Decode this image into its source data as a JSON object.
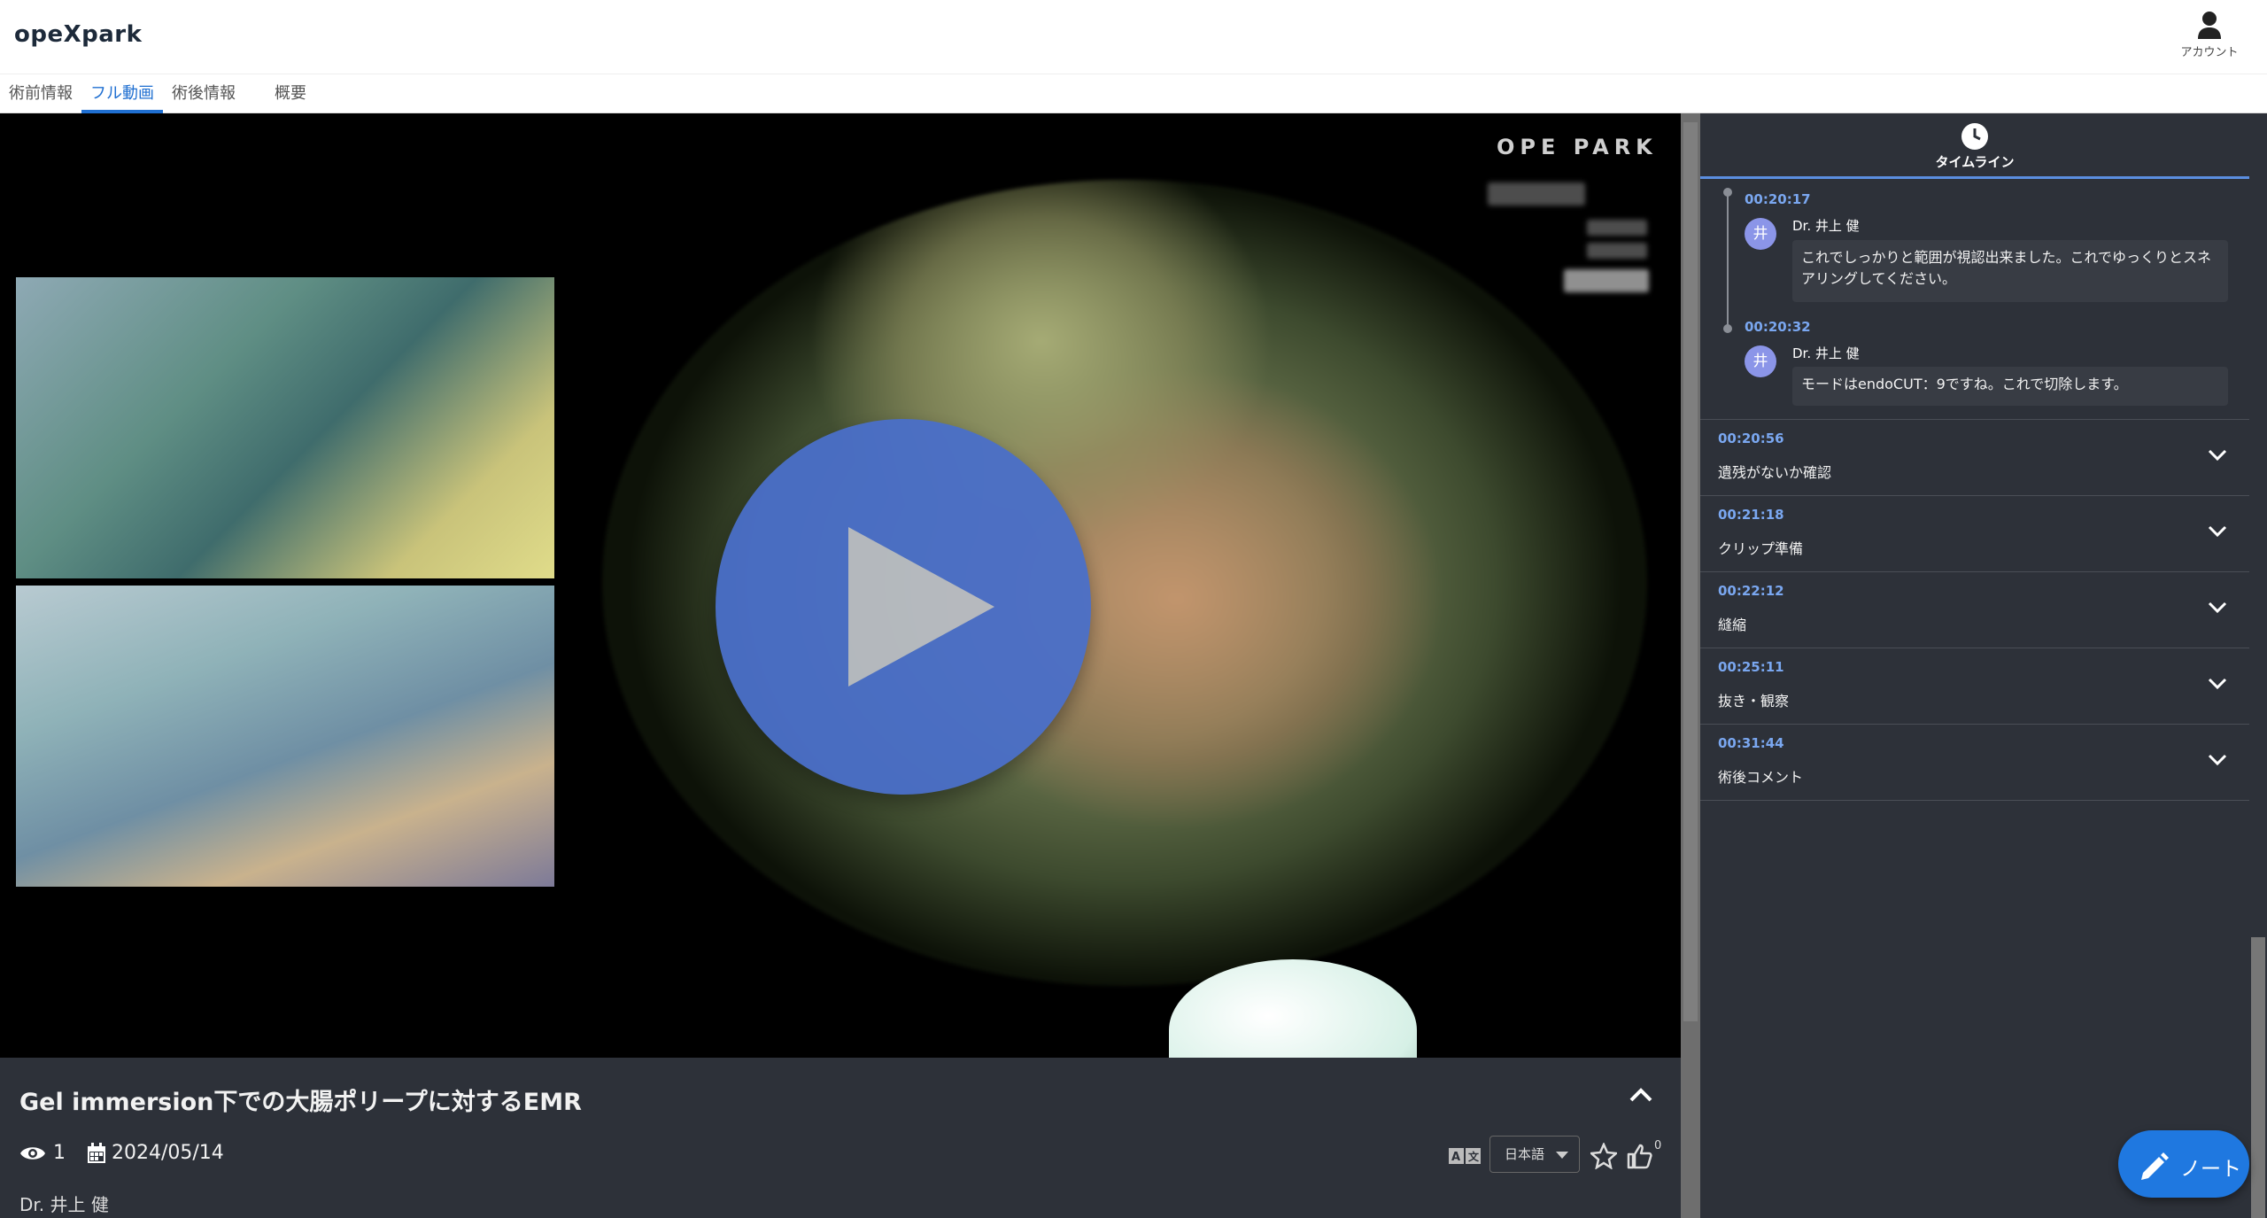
{
  "header": {
    "logo": "opeXpark",
    "account_label": "アカウント",
    "account_icon": "user-icon"
  },
  "tabs": [
    {
      "label": "術前情報",
      "active": false
    },
    {
      "label": "フル動画",
      "active": true
    },
    {
      "label": "術後情報",
      "active": false
    },
    {
      "label": "概要",
      "active": false
    }
  ],
  "video": {
    "overlay_logo": "OPE PARK",
    "play_icon": "play-icon"
  },
  "info": {
    "title": "Gel immersion下での大腸ポリープに対するEMR",
    "views": "1",
    "date": "2024/05/14",
    "author": "Dr. 井上 健",
    "language": "日本語",
    "like_count": "0"
  },
  "timeline": {
    "header_label": "タイムライン",
    "entries": [
      {
        "time": "00:20:17",
        "avatar": "井",
        "author": "Dr. 井上 健",
        "text": "これでしっかりと範囲が視認出来ました。これでゆっくりとスネアリングしてください。"
      },
      {
        "time": "00:20:32",
        "avatar": "井",
        "author": "Dr. 井上 健",
        "text": "モードはendoCUT：9ですね。これで切除します。"
      }
    ],
    "sections": [
      {
        "time": "00:20:56",
        "title": "遺残がないか確認"
      },
      {
        "time": "00:21:18",
        "title": "クリップ準備"
      },
      {
        "time": "00:22:12",
        "title": "縫縮"
      },
      {
        "time": "00:25:11",
        "title": "抜き・観察"
      },
      {
        "time": "00:31:44",
        "title": "術後コメント"
      }
    ]
  },
  "note_button": {
    "label": "ノート",
    "icon": "pencil-icon"
  },
  "colors": {
    "accent": "#1f6fd1",
    "sidebar_bg": "#2d3139",
    "timestamp": "#7aa7f0",
    "play_button": "#4a6fc9",
    "note_button": "#1f78e0"
  }
}
